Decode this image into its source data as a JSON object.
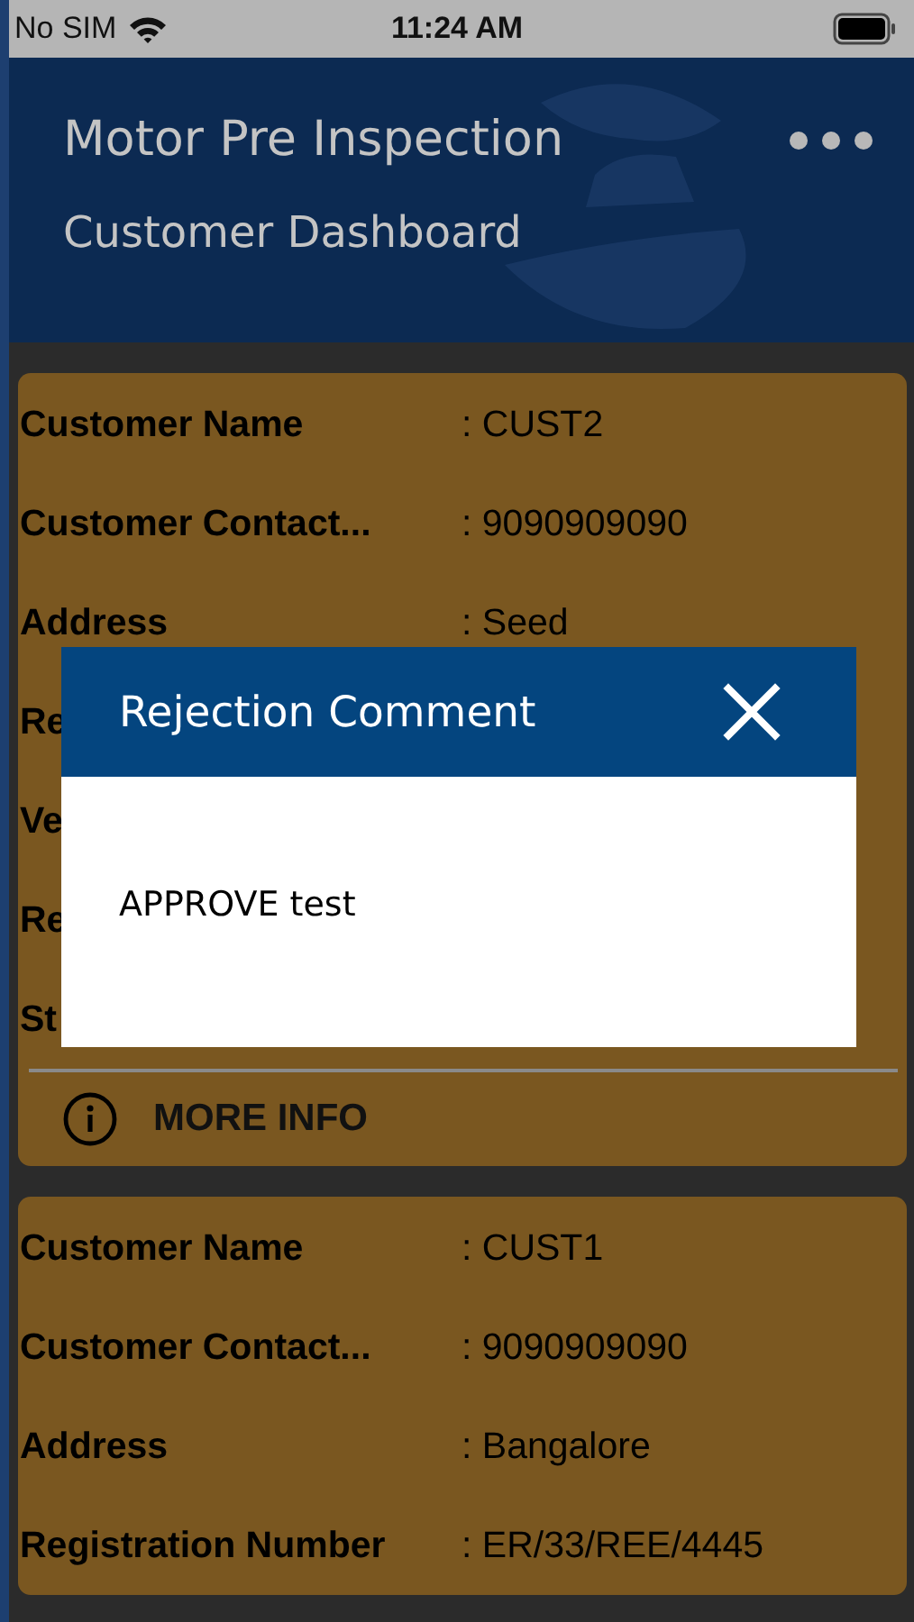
{
  "status_bar": {
    "carrier": "No SIM",
    "time": "11:24 AM"
  },
  "header": {
    "title": "Motor Pre Inspection",
    "subtitle": "Customer Dashboard"
  },
  "cards": [
    {
      "rows": [
        {
          "label": "Customer Name",
          "value": ": CUST2"
        },
        {
          "label": "Customer Contact...",
          "value": ": 9090909090"
        },
        {
          "label": "Address",
          "value": ": Seed"
        },
        {
          "label": "Re"
        },
        {
          "label": "Ve"
        },
        {
          "label": "Re"
        },
        {
          "label": "St"
        }
      ],
      "more_info": "MORE INFO"
    },
    {
      "rows": [
        {
          "label": "Customer Name",
          "value": ": CUST1"
        },
        {
          "label": "Customer Contact...",
          "value": ": 9090909090"
        },
        {
          "label": "Address",
          "value": ": Bangalore"
        },
        {
          "label": "Registration Number",
          "value": ": ER/33/REE/4445"
        }
      ]
    }
  ],
  "dialog": {
    "title": "Rejection Comment",
    "message": "APPROVE test"
  }
}
